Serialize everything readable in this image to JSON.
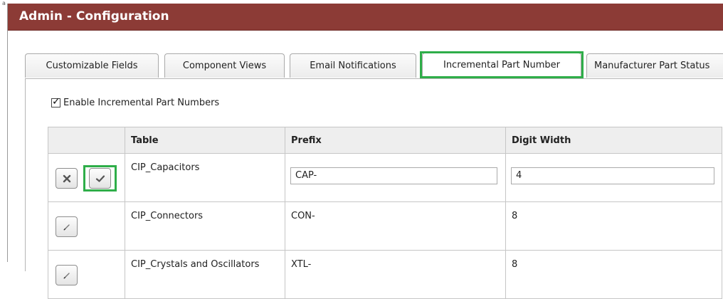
{
  "corner_mark": "a",
  "window": {
    "title": "Admin - Configuration"
  },
  "tabs": [
    {
      "label": "Customizable Fields",
      "active": false
    },
    {
      "label": "Component Views",
      "active": false
    },
    {
      "label": "Email Notifications",
      "active": false
    },
    {
      "label": "Incremental Part Number",
      "active": true
    },
    {
      "label": "Manufacturer Part Status",
      "active": false
    }
  ],
  "panel": {
    "enable_checkbox": {
      "label": "Enable Incremental Part Numbers",
      "checked": true
    }
  },
  "table": {
    "headers": [
      "",
      "Table",
      "Prefix",
      "Digit Width"
    ],
    "rows": [
      {
        "table": "CIP_Capacitors",
        "prefix": "CAP-",
        "digit_width": "4",
        "editing": true,
        "actions": [
          "cancel-icon",
          "check-icon"
        ]
      },
      {
        "table": "CIP_Connectors",
        "prefix": "CON-",
        "digit_width": "8",
        "editing": false,
        "actions": [
          "pencil-icon"
        ]
      },
      {
        "table": "CIP_Crystals and Oscillators",
        "prefix": "XTL-",
        "digit_width": "8",
        "editing": false,
        "actions": [
          "pencil-icon"
        ]
      }
    ]
  },
  "colors": {
    "title_bar": "#8c3b36",
    "highlight": "#2fae49"
  }
}
